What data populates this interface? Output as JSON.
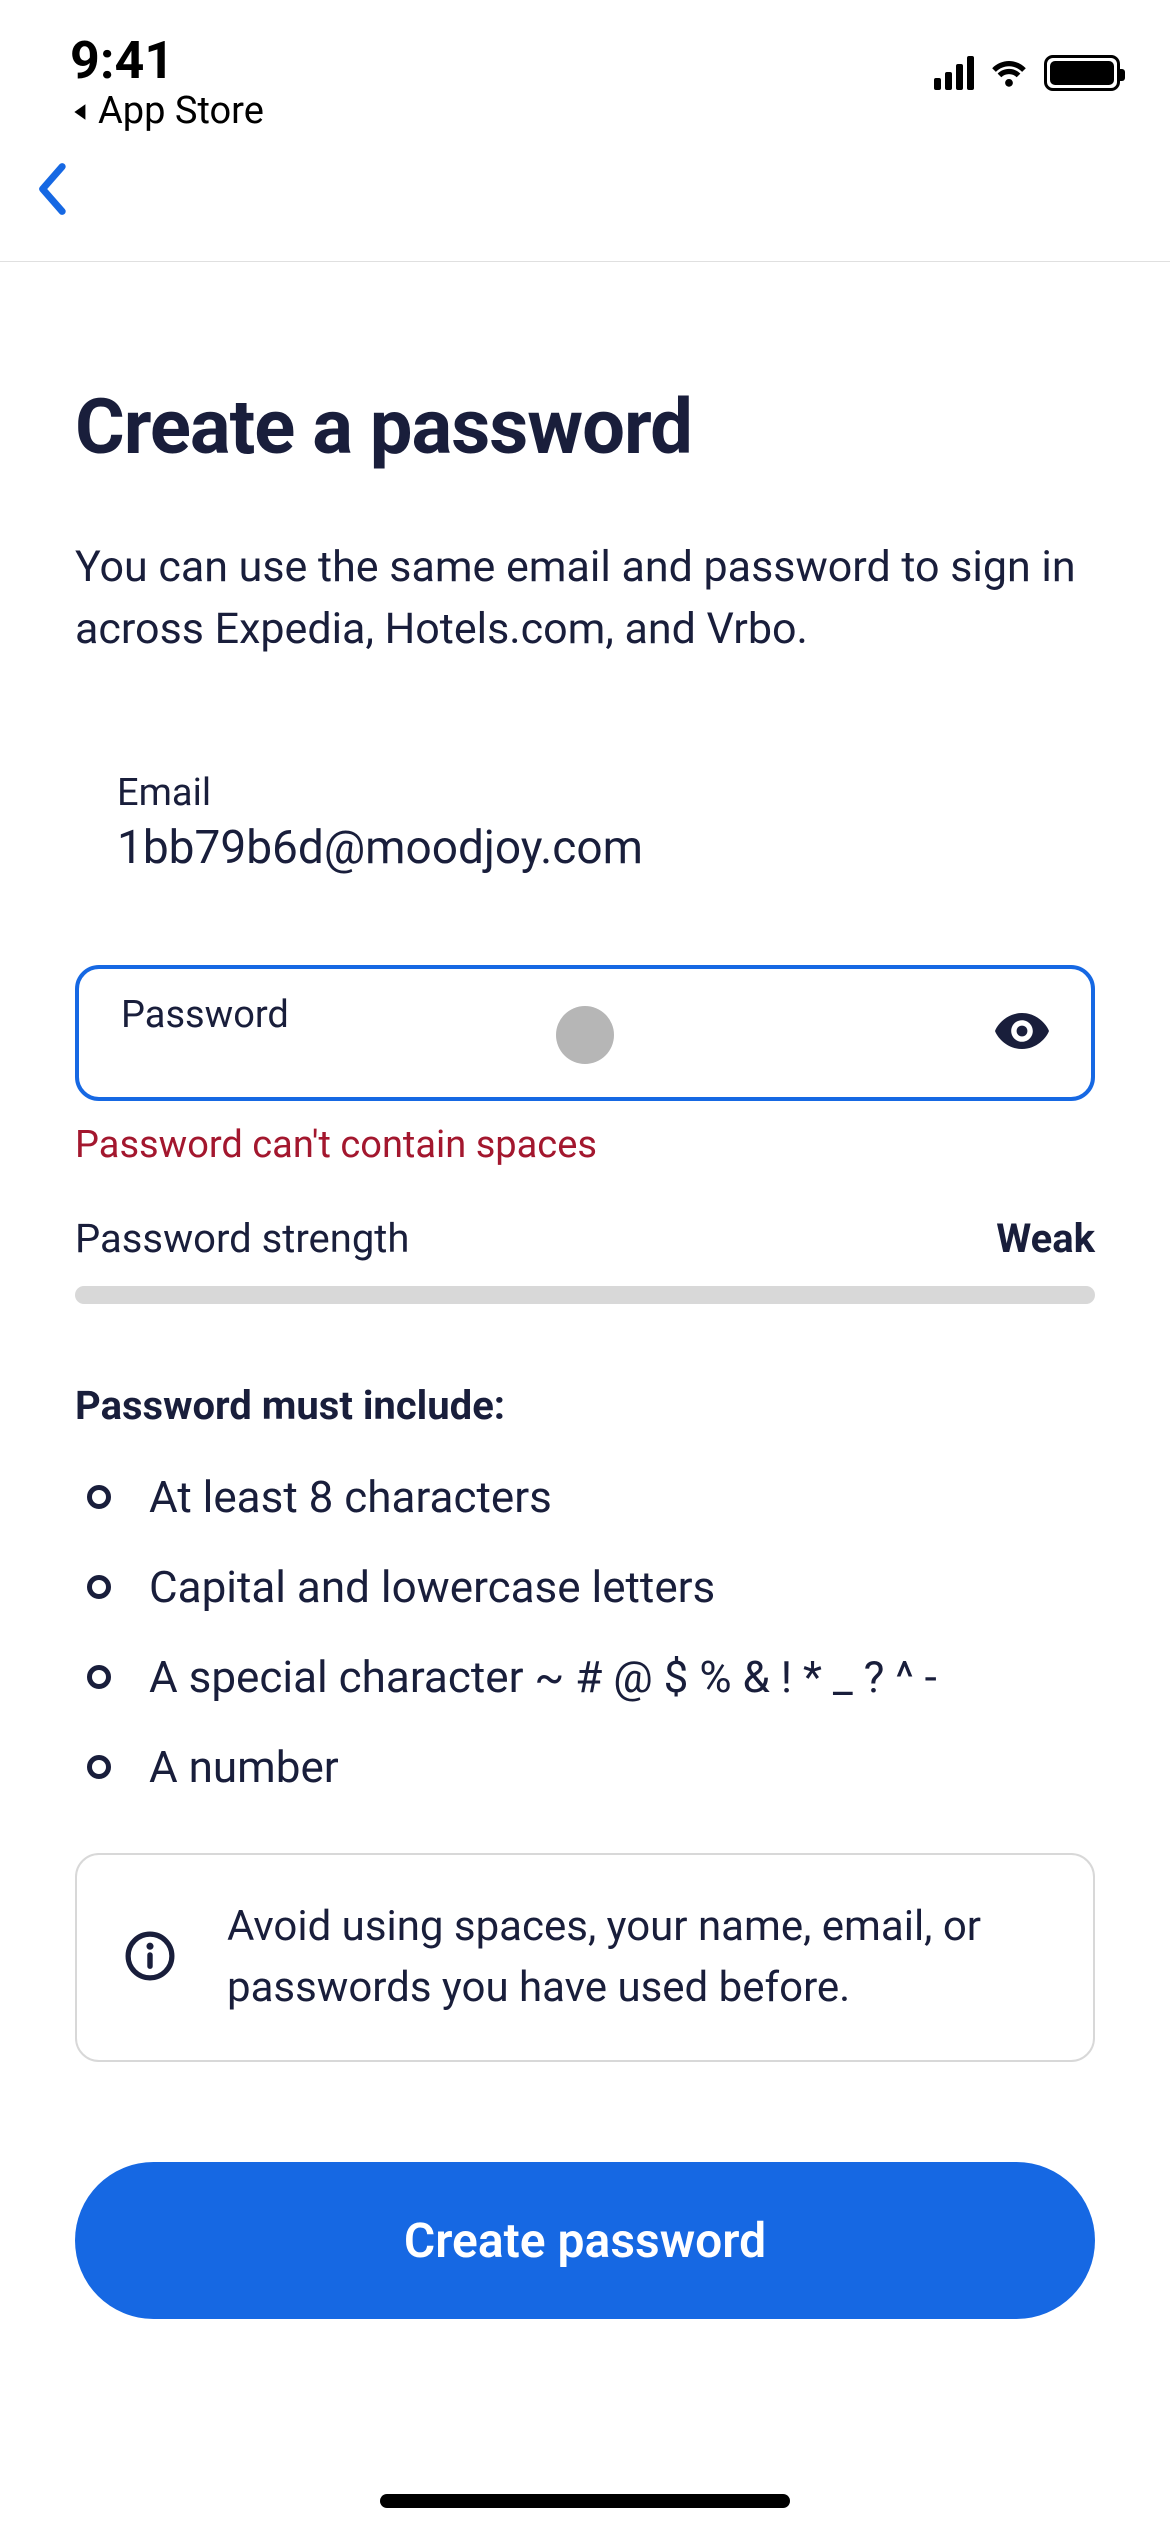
{
  "status_bar": {
    "time": "9:41",
    "back_to_app_label": "App Store"
  },
  "page": {
    "title": "Create a password",
    "subtitle": "You can use the same email and password to sign in across Expedia, Hotels.com, and Vrbo."
  },
  "email": {
    "label": "Email",
    "value": "1bb79b6d@moodjoy.com"
  },
  "password": {
    "label": "Password",
    "error": "Password can't contain spaces"
  },
  "strength": {
    "label": "Password strength",
    "value": "Weak"
  },
  "requirements": {
    "title": "Password must include:",
    "items": [
      "At least 8 characters",
      "Capital and lowercase letters",
      "A special character ~ # @ $ % & ! * _ ? ^ -",
      "A number"
    ]
  },
  "tip": {
    "text": "Avoid using spaces, your name, email, or passwords you have used before."
  },
  "cta": {
    "label": "Create password"
  }
}
